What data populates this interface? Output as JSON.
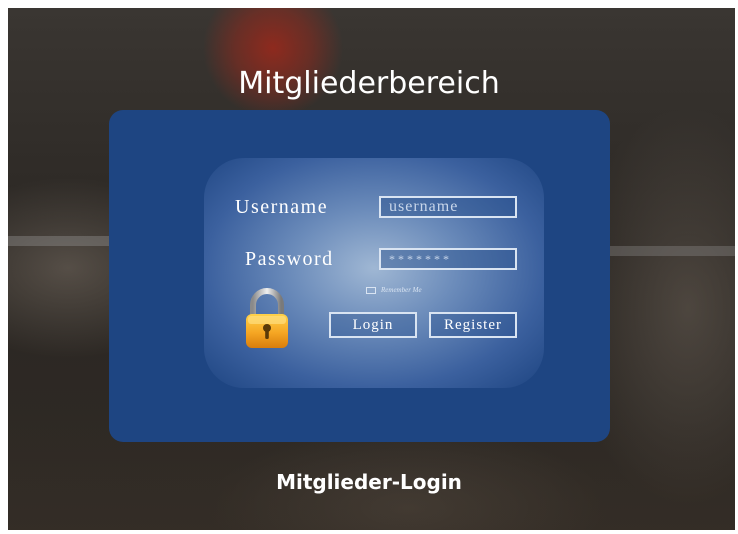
{
  "heading": "Mitgliederbereich",
  "login_image": {
    "username_label": "Username",
    "username_placeholder": "username",
    "password_label": "Password",
    "password_value": "*******",
    "remember_label": "Remember Me",
    "login_button": "Login",
    "register_button": "Register",
    "lock_icon": "padlock-icon"
  },
  "caption": "Mitglieder-Login",
  "colors": {
    "card_blue": "#1e4582",
    "lock_gold": "#f5a623",
    "text": "#ffffff"
  }
}
